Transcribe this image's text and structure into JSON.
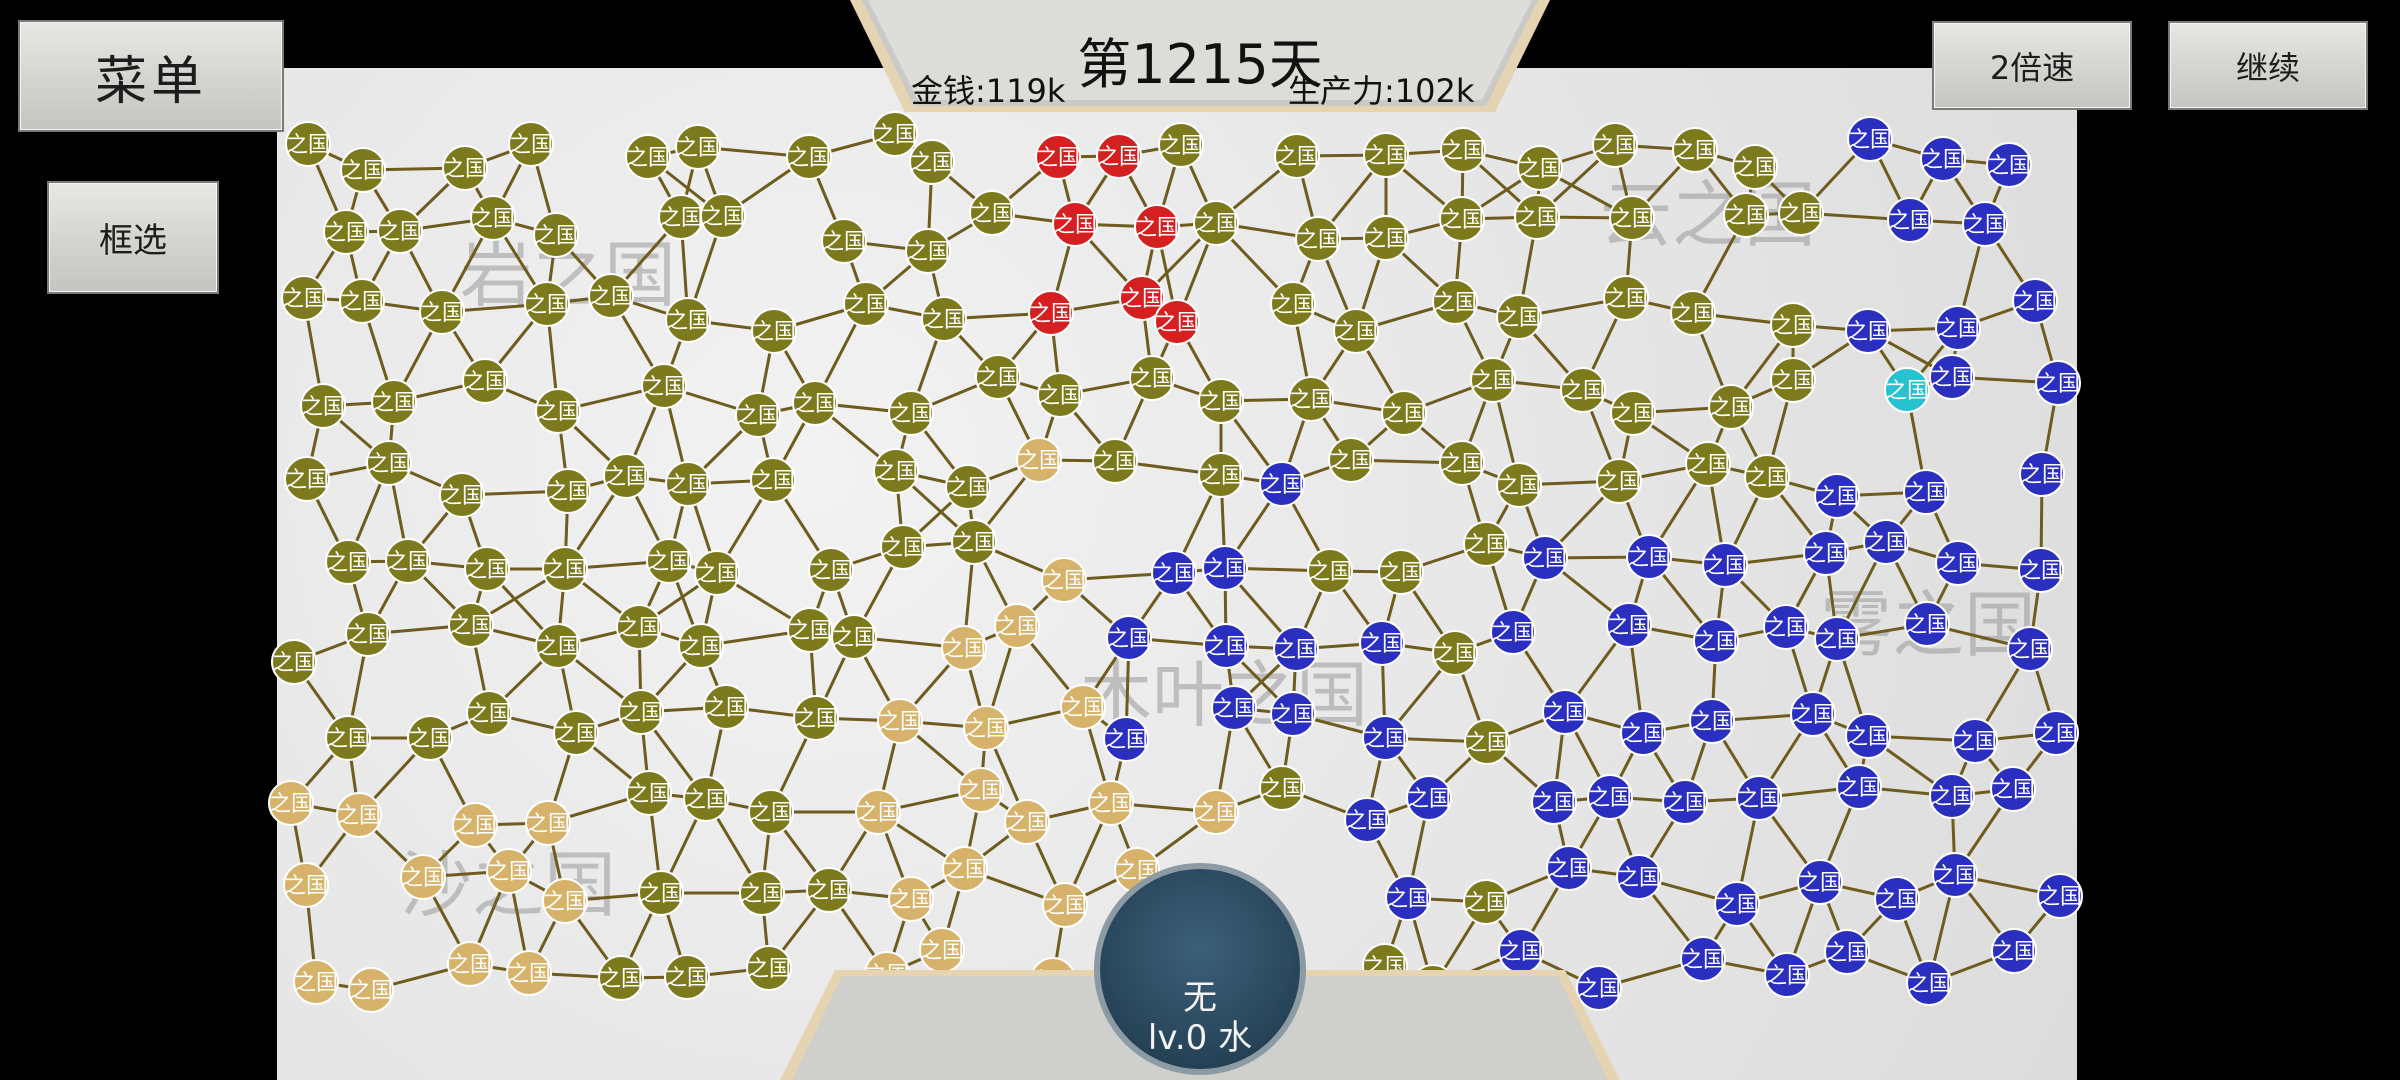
{
  "header": {
    "day": "第1215天",
    "money": "金钱:119k",
    "production": "生产力:102k"
  },
  "buttons": {
    "menu": "菜单",
    "select": "框选",
    "speed": "2倍速",
    "continue": "继续"
  },
  "selected": {
    "name": "无",
    "level": "lv.0 水"
  },
  "map": {
    "node_label": "之国",
    "region_labels": [
      "岩之国",
      "云之国",
      "雾之国",
      "沙之国",
      "木叶之国"
    ],
    "factions": {
      "olive": "#7d7a1e",
      "tan": "#d6b26a",
      "blue": "#2a2fbf",
      "red": "#d42020",
      "cyan": "#27c1cf"
    },
    "edge_color": "#6e5b1e"
  }
}
